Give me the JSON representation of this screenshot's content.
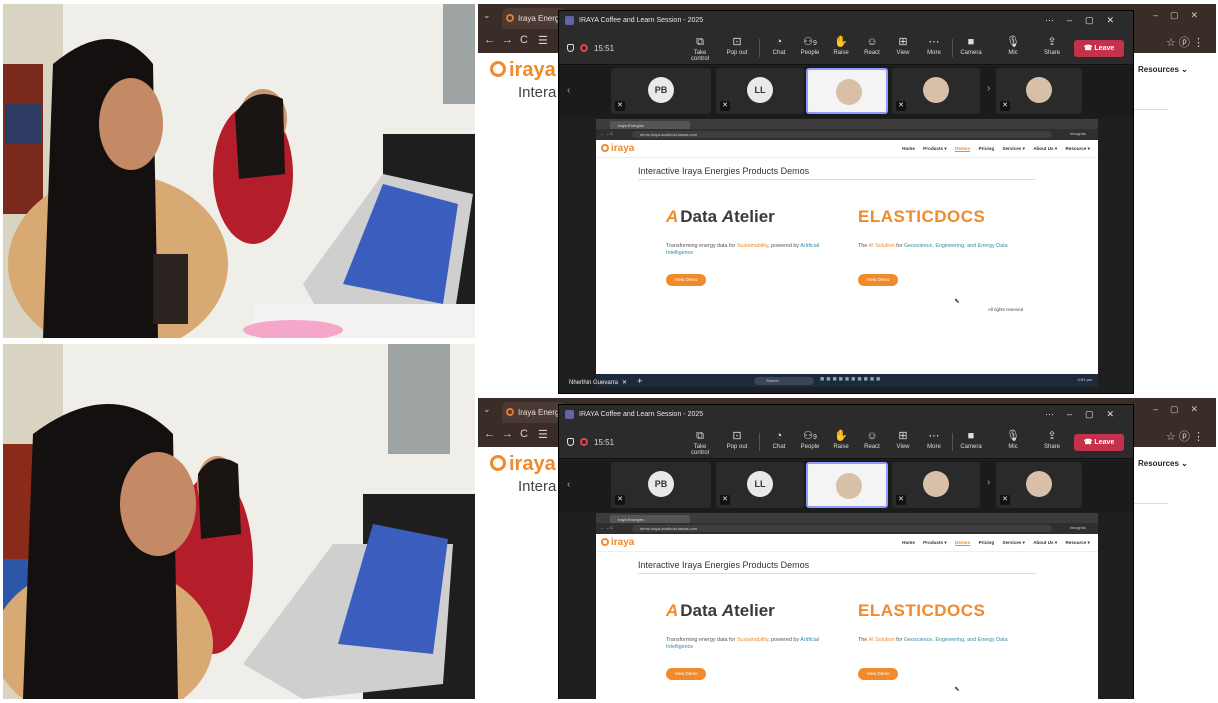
{
  "host_browser": {
    "tab_title": "Iraya Energies |",
    "logo_text": "iraya",
    "heading": "Intera",
    "nav_fragment": "Resources",
    "nav_fragment_chevron": "⌄"
  },
  "teams": {
    "window_title": "IRAYA Coffee and Learn Session - 2025",
    "timer": "15:51",
    "toolbar": [
      {
        "icon": "⧉",
        "label": "Take control"
      },
      {
        "icon": "⊡",
        "label": "Pop out"
      },
      {
        "icon": "◔",
        "label": "Chat"
      },
      {
        "icon": "⚇",
        "label": "People",
        "count": "9"
      },
      {
        "icon": "✋",
        "label": "Raise"
      },
      {
        "icon": "☺",
        "label": "React"
      },
      {
        "icon": "⊞",
        "label": "View"
      },
      {
        "icon": "⋯",
        "label": "More"
      },
      {
        "icon": "■",
        "label": "Camera"
      },
      {
        "icon": "🎙",
        "label": "Mic"
      },
      {
        "icon": "⇪",
        "label": "Share"
      }
    ],
    "leave_label": "Leave",
    "participants": [
      {
        "initials": "PB"
      },
      {
        "initials": "LL"
      }
    ],
    "presenter_name": "Nherlhin Guevarra"
  },
  "shared_screen": {
    "tab_title": "Iraya Energies",
    "url": "demo.iraya.localhost.tassta.com",
    "incognito": "Incognito",
    "logo": "iraya",
    "menu": [
      "Home",
      "Products ▾",
      "Demos",
      "Pricing",
      "Services ▾",
      "About Us ▾",
      "Resource ▾"
    ],
    "active_menu": "Demos",
    "page_heading": "Interactive Iraya Energies Products Demos",
    "products": [
      {
        "name": "Data Atelier",
        "name_parts": {
          "mark": "A",
          "text1": "Data ",
          "text2": "A",
          "text3": "telier"
        },
        "desc_prefix": "Transforming energy data for ",
        "desc_hl1": "Sustainability",
        "desc_mid": ", powered by ",
        "desc_hl2": "Artificial Intelligence",
        "button": "View Demo"
      },
      {
        "name": "ELASTICDOCS",
        "desc_prefix": "The ",
        "desc_hl1": "AI Solution",
        "desc_mid": " for ",
        "desc_hl2": "Geoscience, Engineering, and Energy Data",
        "button": "View Demo"
      }
    ],
    "footer": "All rights reserved",
    "taskbar_search": "Search",
    "clock": "4:51 pm"
  },
  "colors": {
    "brand_orange": "#f08a2a",
    "leave_red": "#c4314b",
    "teams_accent": "#6264a7"
  }
}
